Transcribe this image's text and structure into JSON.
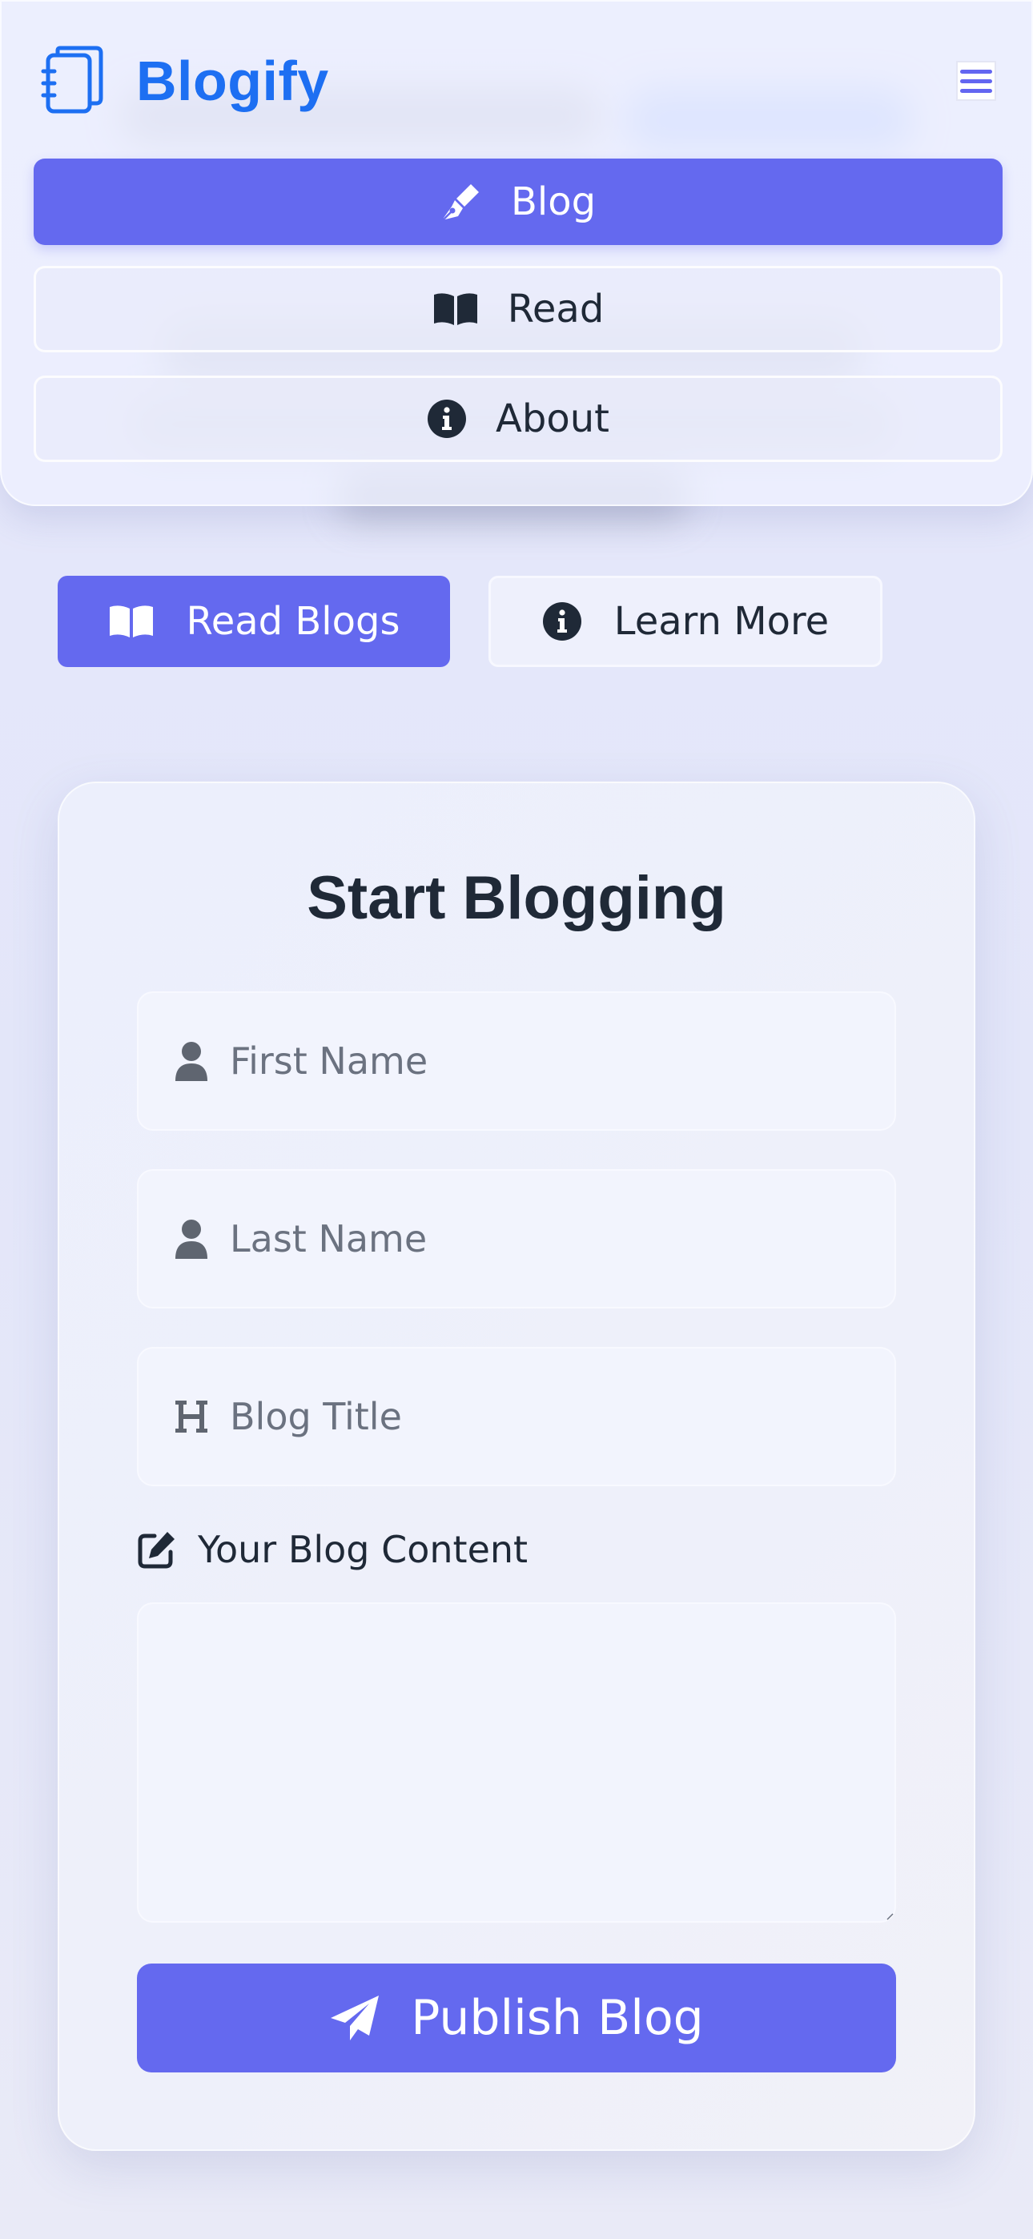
{
  "app": {
    "brand": "Blogify"
  },
  "menu": {
    "items": [
      {
        "label": "Blog",
        "icon": "pen-nib-icon",
        "active": true
      },
      {
        "label": "Read",
        "icon": "book-open-icon",
        "active": false
      },
      {
        "label": "About",
        "icon": "info-circle-icon",
        "active": false
      }
    ]
  },
  "hero": {
    "read_button": "Read Blogs",
    "learn_button": "Learn More"
  },
  "form": {
    "title": "Start Blogging",
    "first_name_placeholder": "First Name",
    "last_name_placeholder": "Last Name",
    "blog_title_placeholder": "Blog Title",
    "content_label": "Your Blog Content",
    "content_value": "",
    "publish_button": "Publish Blog"
  },
  "colors": {
    "accent": "#6469ef",
    "brand": "#1d6ff2",
    "text": "#1f2937",
    "placeholder": "#6b7280"
  }
}
